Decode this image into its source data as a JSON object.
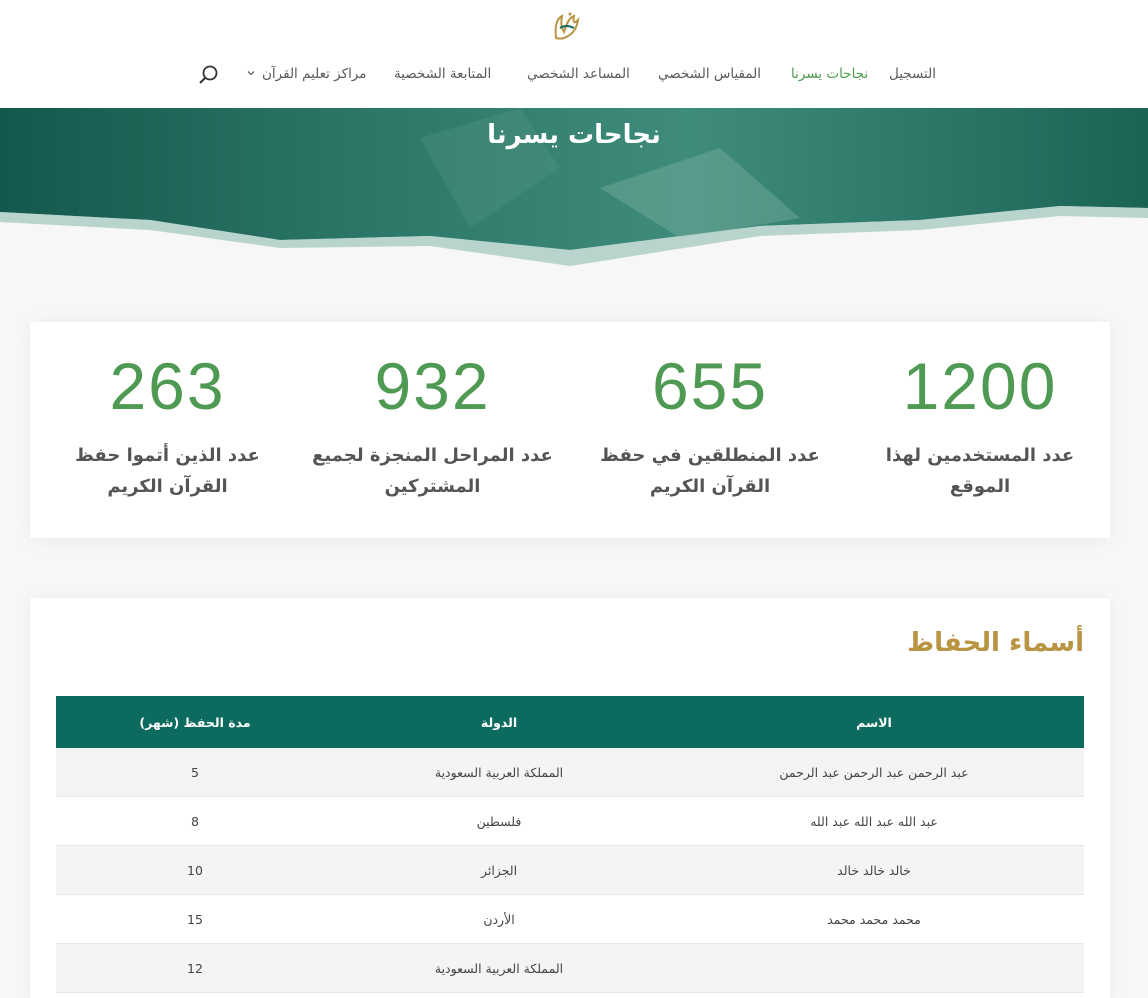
{
  "header": {
    "nav": [
      {
        "id": "register",
        "label": "التسجيل"
      },
      {
        "id": "successes",
        "label": "نجاحات يسرنا"
      },
      {
        "id": "personal-scale",
        "label": "المقياس الشخصي"
      },
      {
        "id": "personal-assistant",
        "label": "المساعد الشخصي"
      },
      {
        "id": "personal-tracking",
        "label": "المتابعة الشخصية"
      },
      {
        "id": "centers",
        "label": "مراكز تعليم القرآن"
      }
    ],
    "active": "نجاحات يسرنا"
  },
  "hero": {
    "title": "نجاحات يسرنا"
  },
  "stats": [
    {
      "value": "1200",
      "label_line1": "عدد المستخدمين لهذا",
      "label_line2": "الموقع"
    },
    {
      "value": "655",
      "label_line1": "عدد المنطلقين في حفظ",
      "label_line2": "القرآن الكريم"
    },
    {
      "value": "932",
      "label_line1": "عدد المراحل المنجزة لجميع",
      "label_line2": "المشتركين"
    },
    {
      "value": "263",
      "label_line1": "عدد الذين أتموا حفظ",
      "label_line2": "القرآن الكريم"
    }
  ],
  "table": {
    "title": "أسماء الحفاظ",
    "headers": {
      "name": "الاسم",
      "country": "الدولة",
      "duration": "مدة الحفظ (شهر)"
    },
    "rows": [
      {
        "name": "عبد الرحمن عبد الرحمن عبد الرحمن",
        "country": "المملكة العربية السعودية",
        "duration": "5"
      },
      {
        "name": "عبد الله عبد الله عبد الله",
        "country": "فلسطين",
        "duration": "8"
      },
      {
        "name": "خالد خالد خالد",
        "country": "الجزائر",
        "duration": "10"
      },
      {
        "name": "محمد محمد محمد",
        "country": "الأردن",
        "duration": "15"
      },
      {
        "name": "",
        "country": "المملكة العربية السعودية",
        "duration": "12"
      }
    ]
  },
  "colors": {
    "accent_green": "#4f9a52",
    "table_header": "#0c6a5e",
    "title_gold": "#b89443",
    "hero_dark": "#1f6e5f"
  },
  "icons": [
    "logo-icon",
    "chevron-down-icon",
    "search-icon"
  ]
}
